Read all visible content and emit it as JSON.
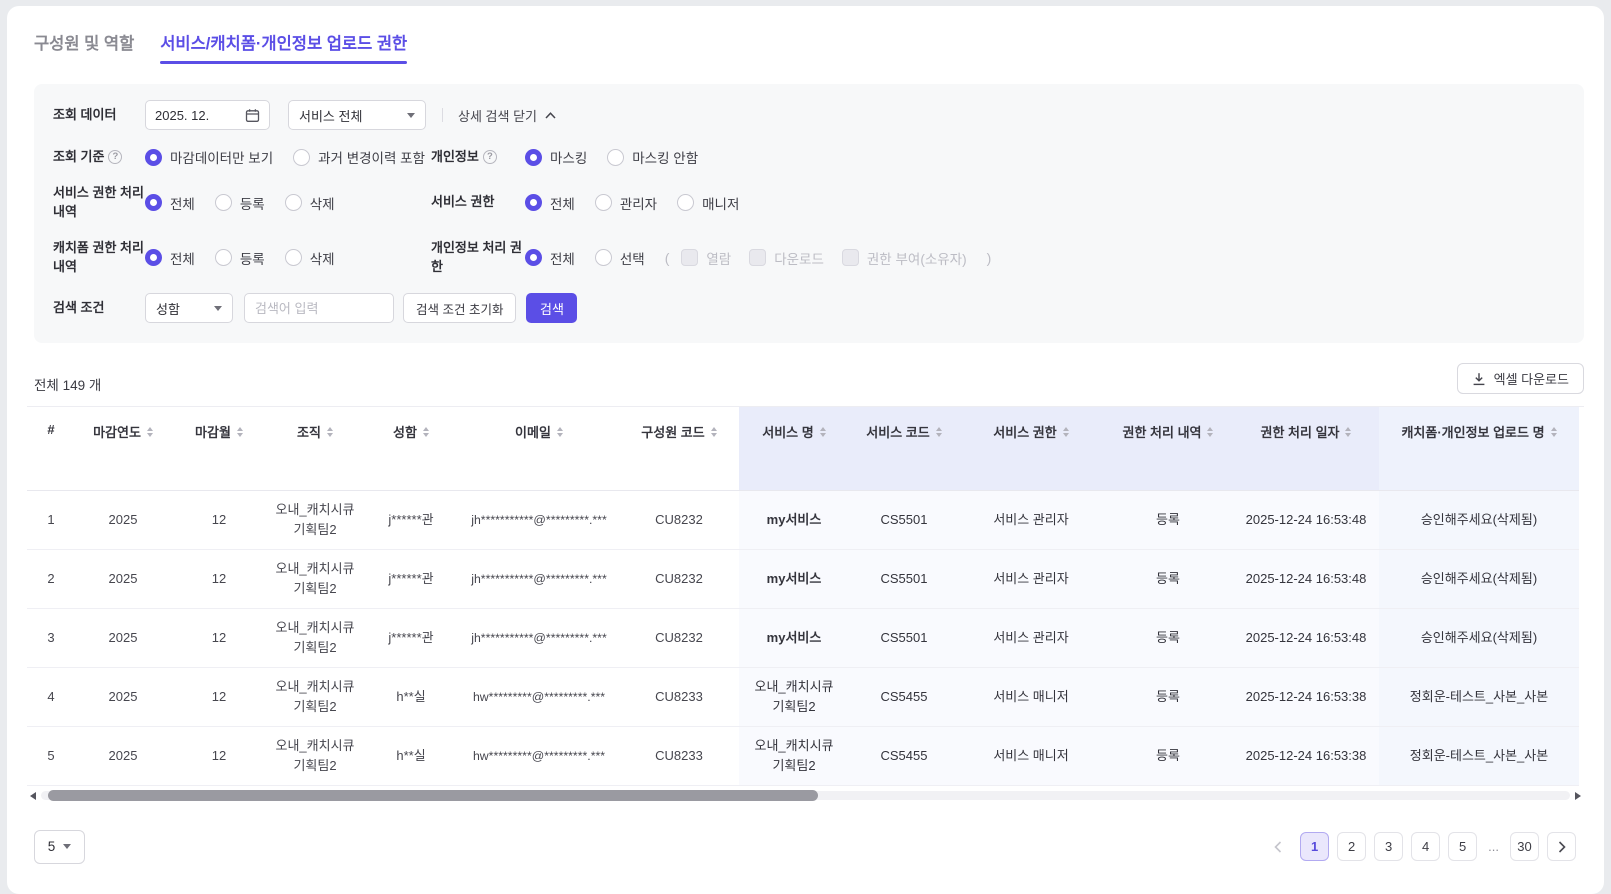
{
  "tabs": {
    "members": "구성원 및 역할",
    "upload_permission": "서비스/캐치폼·개인정보 업로드 권한"
  },
  "filter_panel": {
    "query_data": {
      "label": "조회 데이터",
      "date_value": "2025. 12.",
      "service_select": "서비스 전체",
      "collapse_label": "상세 검색 닫기"
    },
    "query_basis": {
      "label": "조회 기준",
      "options": [
        {
          "label": "마감데이터만 보기",
          "checked": true
        },
        {
          "label": "과거 변경이력 포함",
          "checked": false
        }
      ]
    },
    "personal_info": {
      "label": "개인정보",
      "options": [
        {
          "label": "마스킹",
          "checked": true
        },
        {
          "label": "마스킹 안함",
          "checked": false
        }
      ]
    },
    "service_perm_history": {
      "label": "서비스 권한 처리 내역",
      "options": [
        {
          "label": "전체",
          "checked": true
        },
        {
          "label": "등록",
          "checked": false
        },
        {
          "label": "삭제",
          "checked": false
        }
      ]
    },
    "service_perm": {
      "label": "서비스 권한",
      "options": [
        {
          "label": "전체",
          "checked": true
        },
        {
          "label": "관리자",
          "checked": false
        },
        {
          "label": "매니저",
          "checked": false
        }
      ]
    },
    "catchform_history": {
      "label": "캐치폼 권한 처리 내역",
      "options": [
        {
          "label": "전체",
          "checked": true
        },
        {
          "label": "등록",
          "checked": false
        },
        {
          "label": "삭제",
          "checked": false
        }
      ]
    },
    "privacy_perm": {
      "label": "개인정보 처리 권한",
      "radios": [
        {
          "label": "전체",
          "checked": true
        },
        {
          "label": "선택",
          "checked": false
        }
      ],
      "paren_open": "(",
      "checkboxes": [
        {
          "label": "열람"
        },
        {
          "label": "다운로드"
        },
        {
          "label": "권한 부여(소유자)"
        }
      ],
      "paren_close": ")"
    },
    "search": {
      "label": "검색 조건",
      "field_select": "성함",
      "input_placeholder": "검색어 입력",
      "reset_button": "검색 조건 초기화",
      "search_button": "검색"
    }
  },
  "summary": {
    "total_count": "전체 149 개",
    "excel_button": "엑셀 다운로드"
  },
  "table": {
    "headers": [
      "#",
      "마감연도",
      "마감월",
      "조직",
      "성함",
      "이메일",
      "구성원 코드",
      "서비스 명",
      "서비스 코드",
      "서비스 권한",
      "권한 처리 내역",
      "권한 처리 일자",
      "캐치폼·개인정보 업로드 명"
    ],
    "rows": [
      [
        "1",
        "2025",
        "12",
        "오내_캐치시큐 기획팀2",
        "j******관",
        "jh***********@*********.***",
        "CU8232",
        "my서비스",
        "CS5501",
        "서비스 관리자",
        "등록",
        "2025-12-24 16:53:48",
        "승인해주세요(삭제됨)"
      ],
      [
        "2",
        "2025",
        "12",
        "오내_캐치시큐 기획팀2",
        "j******관",
        "jh***********@*********.***",
        "CU8232",
        "my서비스",
        "CS5501",
        "서비스 관리자",
        "등록",
        "2025-12-24 16:53:48",
        "승인해주세요(삭제됨)"
      ],
      [
        "3",
        "2025",
        "12",
        "오내_캐치시큐 기획팀2",
        "j******관",
        "jh***********@*********.***",
        "CU8232",
        "my서비스",
        "CS5501",
        "서비스 관리자",
        "등록",
        "2025-12-24 16:53:48",
        "승인해주세요(삭제됨)"
      ],
      [
        "4",
        "2025",
        "12",
        "오내_캐치시큐 기획팀2",
        "h**실",
        "hw*********@*********.***",
        "CU8233",
        "오내_캐치시큐 기획팀2",
        "CS5455",
        "서비스 매니저",
        "등록",
        "2025-12-24 16:53:38",
        "정회운-테스트_사본_사본"
      ],
      [
        "5",
        "2025",
        "12",
        "오내_캐치시큐 기획팀2",
        "h**실",
        "hw*********@*********.***",
        "CU8233",
        "오내_캐치시큐 기획팀2",
        "CS5455",
        "서비스 매니저",
        "등록",
        "2025-12-24 16:53:38",
        "정회운-테스트_사본_사본"
      ]
    ]
  },
  "pagination": {
    "page_size": "5",
    "pages": [
      "1",
      "2",
      "3",
      "4",
      "5"
    ],
    "ellipsis": "...",
    "last_page": "30"
  }
}
